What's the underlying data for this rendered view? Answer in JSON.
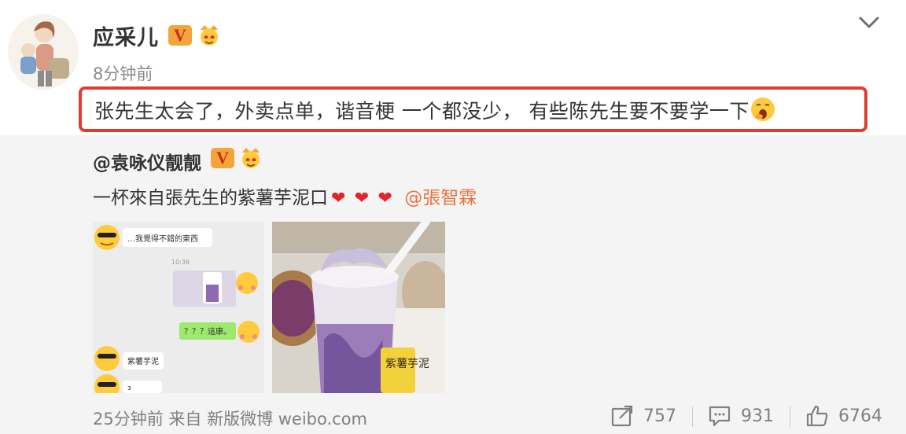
{
  "post": {
    "username": "应采儿",
    "verified_badge": "V",
    "timestamp": "8分钟前",
    "text": "张先生太会了，外卖点单，谐音梗 一个都没少， 有些陈先生要不要学一下"
  },
  "repost": {
    "username": "@袁咏仪靓靓",
    "verified_badge": "V",
    "text": "一杯來自張先生的紫薯芋泥口",
    "hearts": [
      "❤",
      "❤",
      "❤"
    ],
    "mention": "@張智霖",
    "chat_thumb": {
      "msg1": "…我覺得不錯的東西",
      "time": "10:36",
      "msg2": "？？？這康。",
      "msg3": "紫薯芋泥",
      "msg4": "з"
    },
    "drink_thumb": {
      "label": "紫薯芋泥"
    },
    "footer": {
      "meta": "25分钟前 来自 新版微博 weibo.com",
      "reposts": "757",
      "comments": "931",
      "likes": "6764"
    }
  },
  "colors": {
    "highlight_border": "#e33b2e",
    "mention": "#eb7340",
    "repost_bg": "#f4f4f4",
    "badge_bg": "#f3a43a"
  }
}
